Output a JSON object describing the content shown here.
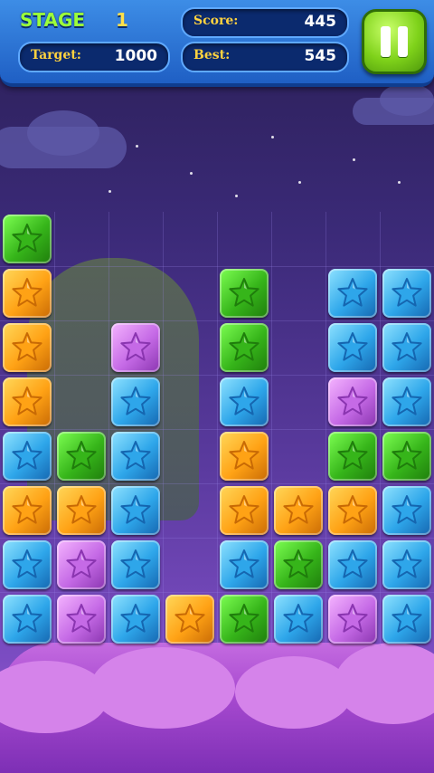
{
  "hud": {
    "stage_label": "STAGE",
    "stage_value": "1",
    "target_label": "Target:",
    "target_value": "1000",
    "score_label": "Score:",
    "score_value": "445",
    "best_label": "Best:",
    "best_value": "545"
  },
  "colors": {
    "green": "#4fd22e",
    "orange": "#ffae21",
    "blue": "#35b2ef",
    "purple": "#d77ff0",
    "empty": null
  },
  "board": {
    "columns": 8,
    "rows": 8,
    "cells": [
      [
        "green",
        null,
        null,
        null,
        null,
        null,
        null,
        null
      ],
      [
        "orange",
        null,
        null,
        null,
        "green",
        null,
        "blue",
        "blue"
      ],
      [
        "orange",
        null,
        "purple",
        null,
        "green",
        null,
        "blue",
        "blue"
      ],
      [
        "orange",
        null,
        "blue",
        null,
        "blue",
        null,
        "purple",
        "blue"
      ],
      [
        "blue",
        "green",
        "blue",
        null,
        "orange",
        null,
        "green",
        "green"
      ],
      [
        "orange",
        "orange",
        "blue",
        null,
        "orange",
        "orange",
        "orange",
        "blue"
      ],
      [
        "blue",
        "purple",
        "blue",
        null,
        "blue",
        "green",
        "blue",
        "blue"
      ],
      [
        "blue",
        "purple",
        "blue",
        "orange",
        "green",
        "blue",
        "purple",
        "blue"
      ]
    ]
  }
}
